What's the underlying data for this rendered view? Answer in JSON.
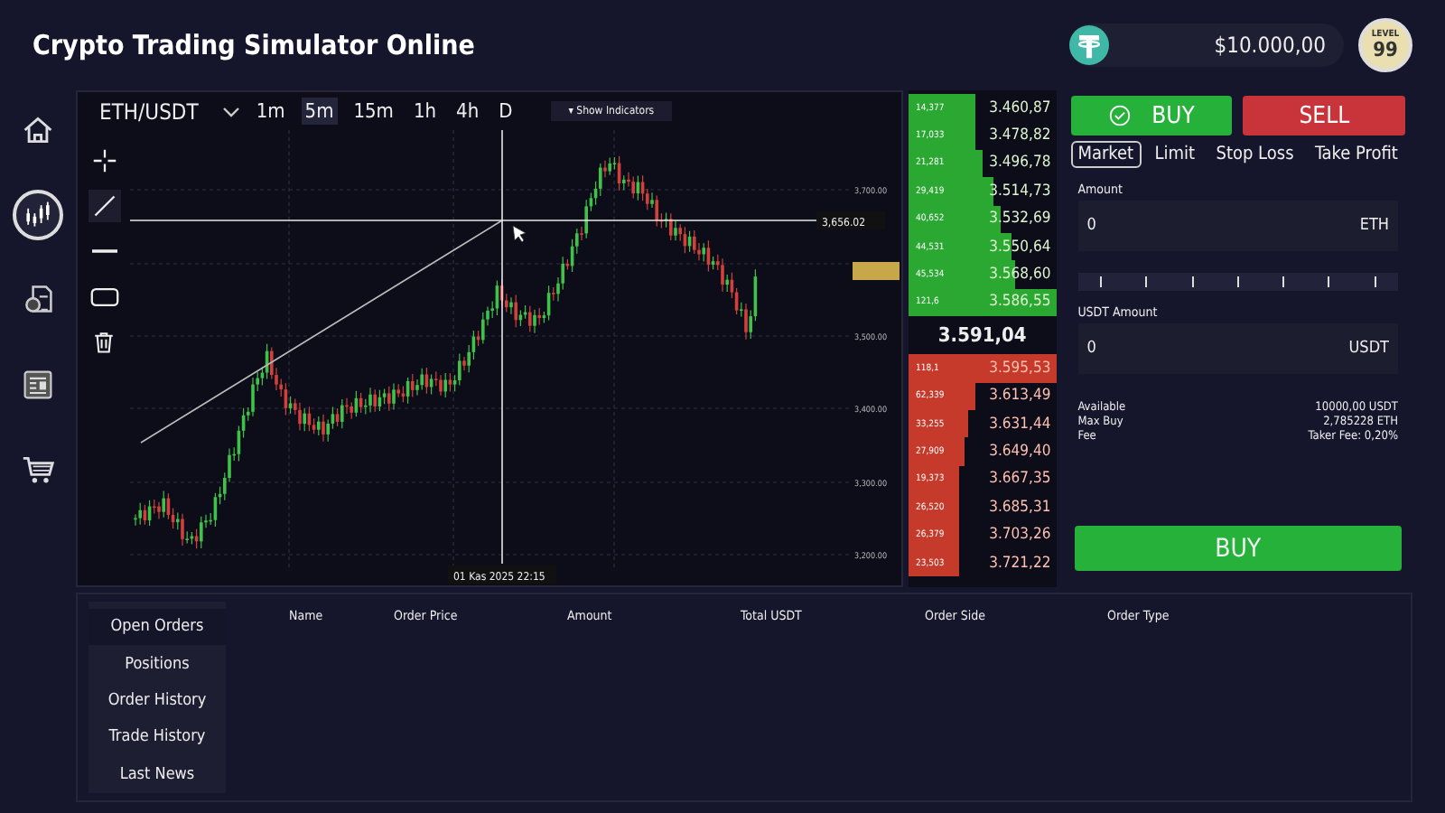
{
  "app": {
    "title": "Crypto Trading Simulator Online",
    "balance": "$10.000,00",
    "level_caption": "LEVEL",
    "level": "99"
  },
  "nav": [
    {
      "kind": "home",
      "selected": false
    },
    {
      "kind": "chart",
      "selected": true
    },
    {
      "kind": "docs",
      "selected": false
    },
    {
      "kind": "news",
      "selected": false
    },
    {
      "kind": "cart",
      "selected": false
    }
  ],
  "chart": {
    "pair": "ETH/USDT",
    "timeframes": [
      {
        "label": "1m",
        "selected": false
      },
      {
        "label": "5m",
        "selected": true
      },
      {
        "label": "15m",
        "selected": false
      },
      {
        "label": "1h",
        "selected": false
      },
      {
        "label": "4h",
        "selected": false
      },
      {
        "label": "D",
        "selected": false
      }
    ],
    "indicators_button": "▾ Show Indicators",
    "tools": [
      {
        "kind": "crosshair",
        "selected": false
      },
      {
        "kind": "line",
        "selected": true
      },
      {
        "kind": "hline",
        "selected": false
      },
      {
        "kind": "rect",
        "selected": false
      },
      {
        "kind": "trash",
        "selected": false
      }
    ],
    "price_labels": [
      "3,700.00",
      "3,500.00",
      "3,400.00",
      "3,300.00",
      "3,200.00"
    ],
    "crosshair_price": "3,656.02",
    "crosshair_time": "01 Kas 2025 22:15"
  },
  "order_book": {
    "buy_orders": [
      {
        "qty": "14,377",
        "price": "3.460,87"
      },
      {
        "qty": "17,033",
        "price": "3.478,82"
      },
      {
        "qty": "21,281",
        "price": "3.496,78"
      },
      {
        "qty": "29,419",
        "price": "3.514,73"
      },
      {
        "qty": "40,652",
        "price": "3.532,69"
      },
      {
        "qty": "44,531",
        "price": "3.550,64"
      },
      {
        "qty": "45,534",
        "price": "3.568,60"
      },
      {
        "qty": "121,6",
        "price": "3.586,55"
      }
    ],
    "last_price": "3.591,04",
    "sell_orders": [
      {
        "qty": "118,1",
        "price": "3.595,53"
      },
      {
        "qty": "62,339",
        "price": "3.613,49"
      },
      {
        "qty": "33,255",
        "price": "3.631,44"
      },
      {
        "qty": "27,909",
        "price": "3.649,40"
      },
      {
        "qty": "19,373",
        "price": "3.667,35"
      },
      {
        "qty": "26,520",
        "price": "3.685,31"
      },
      {
        "qty": "26,379",
        "price": "3.703,26"
      },
      {
        "qty": "23,503",
        "price": "3.721,22"
      }
    ]
  },
  "trade": {
    "sides": [
      {
        "label": "BUY",
        "kind": "buy",
        "selected": true
      },
      {
        "label": "SELL",
        "kind": "sell",
        "selected": false
      }
    ],
    "order_types": [
      {
        "label": "Market",
        "selected": true
      },
      {
        "label": "Limit",
        "selected": false
      },
      {
        "label": "Stop Loss",
        "selected": false
      },
      {
        "label": "Take Profit",
        "selected": false
      }
    ],
    "amount": {
      "label": "Amount",
      "value": "0",
      "unit": "ETH"
    },
    "usdt_amount": {
      "label": "USDT Amount",
      "value": "0",
      "unit": "USDT"
    },
    "info": [
      {
        "label": "Available",
        "value": "10000,00 USDT"
      },
      {
        "label": "Max Buy",
        "value": "2,785228 ETH"
      },
      {
        "label": "Fee",
        "value": "Taker Fee: 0,20%"
      }
    ],
    "submit": "BUY"
  },
  "orders": {
    "tabs": [
      {
        "label": "Open Orders",
        "selected": true
      },
      {
        "label": "Positions",
        "selected": false
      },
      {
        "label": "Order History",
        "selected": false
      },
      {
        "label": "Trade History",
        "selected": false
      },
      {
        "label": "Last News",
        "selected": false
      }
    ],
    "columns": [
      "Name",
      "Order Price",
      "Amount",
      "Total USDT",
      "Order Side",
      "Order Type"
    ]
  }
}
